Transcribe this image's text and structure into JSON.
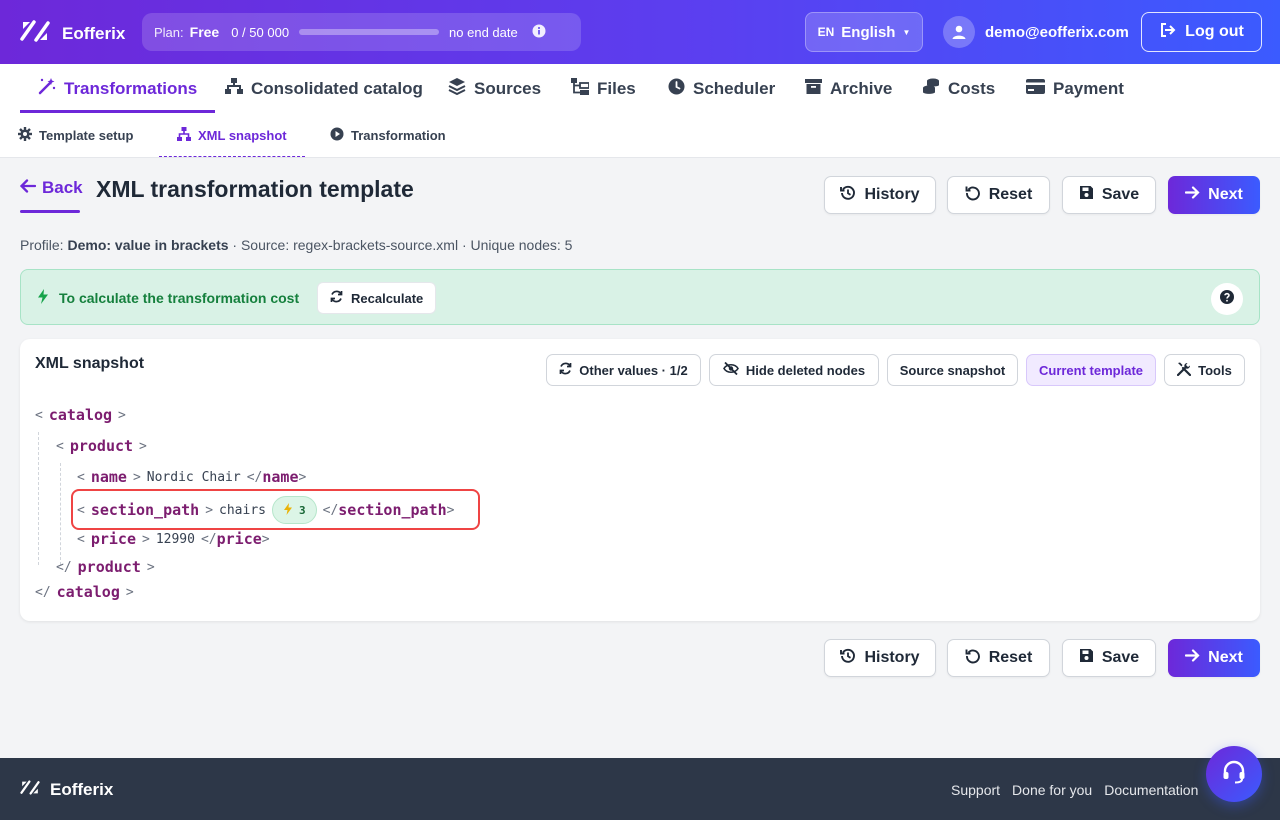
{
  "brand": {
    "name": "Eofferix"
  },
  "plan": {
    "label": "Plan:",
    "value": "Free",
    "usage": "0 / 50 000",
    "progress": 0,
    "end_date": "no end date"
  },
  "language": {
    "code": "EN",
    "name": "English"
  },
  "user": {
    "email": "demo@eofferix.com"
  },
  "logout_label": "Log out",
  "main_nav": [
    {
      "label": "Transformations",
      "icon": "wand-icon",
      "active": true
    },
    {
      "label": "Consolidated catalog",
      "icon": "sitemap-icon"
    },
    {
      "label": "Sources",
      "icon": "layers-icon"
    },
    {
      "label": "Files",
      "icon": "folder-tree-icon"
    },
    {
      "label": "Scheduler",
      "icon": "clock-icon"
    },
    {
      "label": "Archive",
      "icon": "archive-icon"
    },
    {
      "label": "Costs",
      "icon": "coins-icon"
    },
    {
      "label": "Payment",
      "icon": "credit-card-icon"
    }
  ],
  "sub_nav": [
    {
      "label": "Template setup",
      "icon": "gear-icon"
    },
    {
      "label": "XML snapshot",
      "icon": "sitemap-icon",
      "active": true
    },
    {
      "label": "Transformation",
      "icon": "play-circle-icon"
    }
  ],
  "header": {
    "back_label": "Back",
    "title": "XML transformation template",
    "actions": {
      "history": "History",
      "reset": "Reset",
      "save": "Save",
      "next": "Next"
    }
  },
  "meta": {
    "profile_label": "Profile:",
    "profile_name": "Demo: value in brackets",
    "source_text": "· Source: regex-brackets-source.xml · Unique nodes: 5"
  },
  "banner": {
    "message": "To calculate the transformation cost",
    "recalculate_label": "Recalculate"
  },
  "snapshot": {
    "title": "XML snapshot",
    "toolbar": {
      "other_values": "Other values · 1/2",
      "hide_deleted": "Hide deleted nodes",
      "source_snapshot": "Source snapshot",
      "current_template": "Current template",
      "tools": "Tools"
    },
    "xml": {
      "catalog": "catalog",
      "product": "product",
      "name_tag": "name",
      "name_value": "Nordic Chair",
      "section_tag": "section_path",
      "section_value": "chairs",
      "section_badge": "3",
      "price_tag": "price",
      "price_value": "12990"
    }
  },
  "footer": {
    "brand": "Eofferix",
    "links": [
      "Support",
      "Done for you",
      "Documentation"
    ]
  },
  "colors": {
    "accent": "#6d28d9",
    "accent_blue": "#3b5bff",
    "success_bg": "#d9f2e6",
    "highlight": "#ef4444"
  }
}
